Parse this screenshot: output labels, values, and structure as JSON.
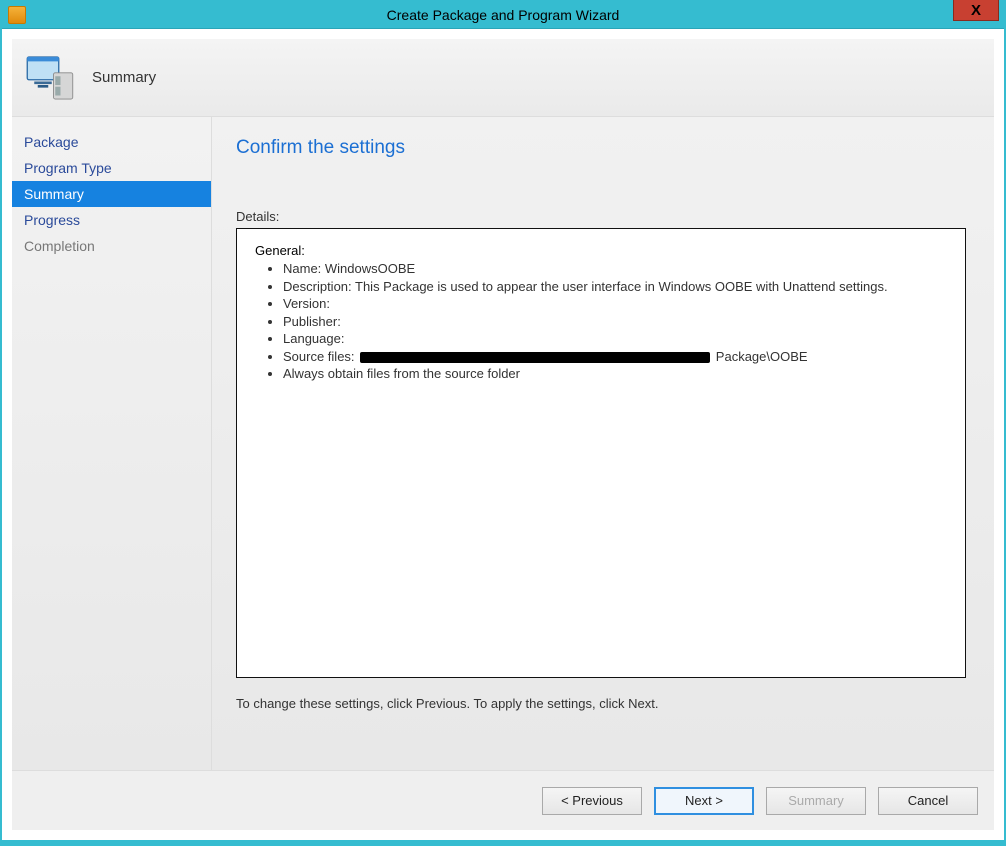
{
  "window_title": "Create Package and Program Wizard",
  "close_glyph": "X",
  "header": {
    "title": "Summary"
  },
  "sidebar": {
    "items": [
      {
        "label": "Package",
        "selected": false,
        "disabled": false
      },
      {
        "label": "Program Type",
        "selected": false,
        "disabled": false
      },
      {
        "label": "Summary",
        "selected": true,
        "disabled": false
      },
      {
        "label": "Progress",
        "selected": false,
        "disabled": false
      },
      {
        "label": "Completion",
        "selected": false,
        "disabled": true
      }
    ]
  },
  "content": {
    "heading": "Confirm the settings",
    "details_label": "Details:",
    "general_label": "General:",
    "items": {
      "name": "Name: WindowsOOBE",
      "description": "Description: This Package is used to appear the user interface in Windows OOBE with Unattend settings.",
      "version": "Version:",
      "publisher": "Publisher:",
      "language": "Language:",
      "source_prefix": "Source files:",
      "source_suffix": "Package\\OOBE",
      "always_obtain": "Always obtain files from the source folder"
    },
    "hint": "To change these settings, click Previous. To apply the settings, click Next."
  },
  "buttons": {
    "previous": "< Previous",
    "next": "Next >",
    "summary": "Summary",
    "cancel": "Cancel"
  }
}
